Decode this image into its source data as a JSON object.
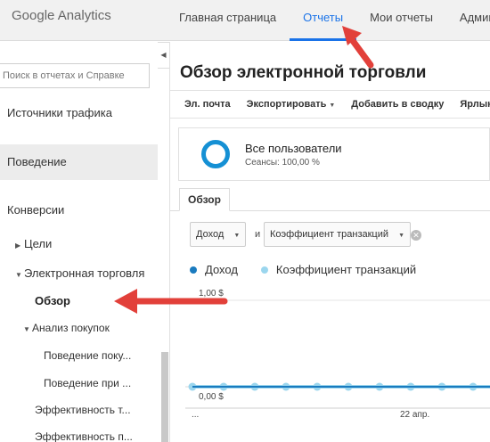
{
  "header": {
    "logo": "Google Analytics",
    "tabs": [
      {
        "label": "Главная страница"
      },
      {
        "label": "Отчеты"
      },
      {
        "label": "Мои отчеты"
      },
      {
        "label": "Админ"
      }
    ],
    "active_tab": "Отчеты"
  },
  "sidebar": {
    "search_placeholder": "Поиск в отчетах и Справке",
    "items": [
      {
        "label": "Источники трафика"
      },
      {
        "label": "Поведение"
      },
      {
        "label": "Конверсии"
      },
      {
        "label": "Цели"
      },
      {
        "label": "Электронная торговля"
      },
      {
        "label": "Обзор"
      },
      {
        "label": "Анализ покупок"
      },
      {
        "label": "Поведение поку..."
      },
      {
        "label": "Поведение при ..."
      },
      {
        "label": "Эффективность т..."
      },
      {
        "label": "Эффективность п..."
      }
    ]
  },
  "main": {
    "title": "Обзор электронной торговли",
    "toolbar": {
      "email": "Эл. почта",
      "export": "Экспортировать",
      "add_to_dashboard": "Добавить в сводку",
      "shortcut": "Ярлык"
    },
    "segment": {
      "name": "Все пользователи",
      "sessions": "Сеансы: 100,00 %"
    },
    "tab": "Обзор",
    "metric1": "Доход",
    "and_label": "и",
    "metric2": "Коэффициент транзакций",
    "legend": [
      {
        "name": "Доход",
        "color": "#1a7bbf"
      },
      {
        "name": "Коэффициент транзакций",
        "color": "#9bd6ee"
      }
    ]
  },
  "chart_data": {
    "type": "line",
    "y_ticks": [
      "1,00 $",
      "0,00 $"
    ],
    "x_ticks": [
      "...",
      "22 апр."
    ],
    "series": [
      {
        "name": "Доход",
        "values": [
          0,
          0,
          0,
          0,
          0,
          0,
          0,
          0,
          0,
          0,
          0
        ]
      },
      {
        "name": "Коэффициент транзакций",
        "values": [
          0,
          0,
          0,
          0,
          0,
          0,
          0,
          0,
          0,
          0,
          0
        ]
      }
    ],
    "ylim": [
      0,
      1
    ]
  },
  "colors": {
    "accent": "#1a73e8",
    "arrow": "#e2403a"
  }
}
